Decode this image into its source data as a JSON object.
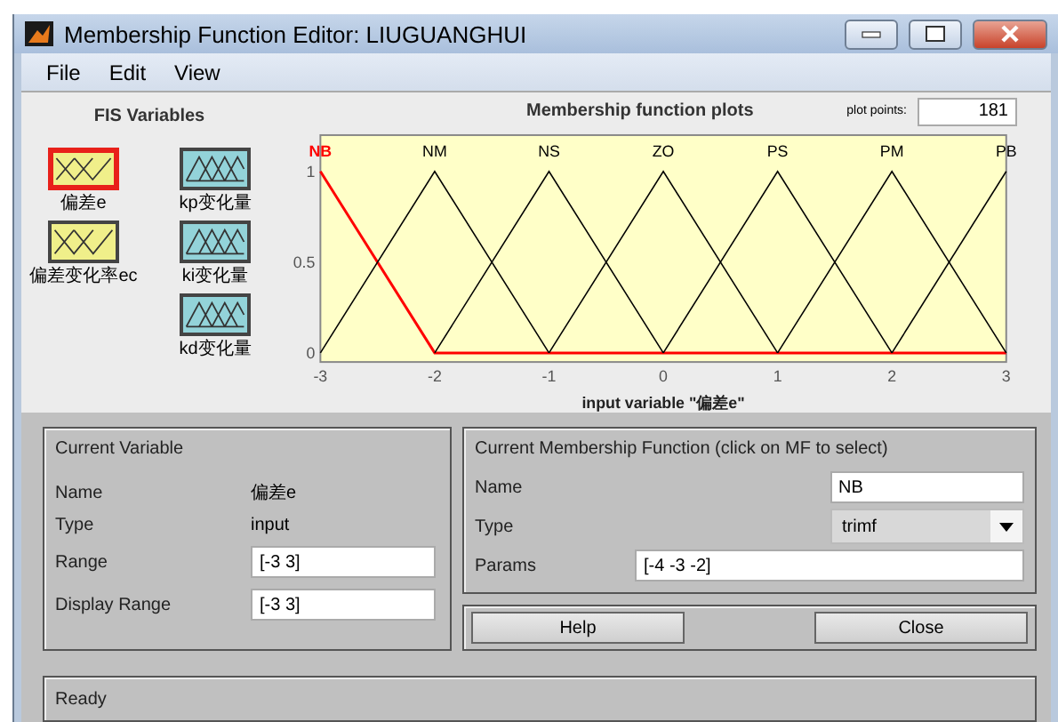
{
  "window": {
    "title": "Membership Function Editor: LIUGUANGHUI"
  },
  "menu": [
    "File",
    "Edit",
    "View"
  ],
  "fis_variables": {
    "title": "FIS Variables",
    "items": [
      {
        "label": "偏差e",
        "kind": "input",
        "selected": true
      },
      {
        "label": "kp变化量",
        "kind": "output",
        "selected": false
      },
      {
        "label": "偏差变化率ec",
        "kind": "input",
        "selected": false
      },
      {
        "label": "ki变化量",
        "kind": "output",
        "selected": false
      },
      {
        "label": "kd变化量",
        "kind": "output",
        "selected": false
      }
    ]
  },
  "plot": {
    "title": "Membership function plots",
    "plot_points_label": "plot points:",
    "plot_points": "181",
    "chart_data": {
      "type": "line",
      "xlabel": "input variable \"偏差e\"",
      "x": [
        -3,
        -2,
        -1,
        0,
        1,
        2,
        3
      ],
      "xlim": [
        -3,
        3
      ],
      "ylim": [
        -0.05,
        1.2
      ],
      "xticks": [
        -3,
        -2,
        -1,
        0,
        1,
        2,
        3
      ],
      "yticks": [
        0,
        0.5,
        1
      ],
      "series": [
        {
          "name": "NB",
          "color": "#ff0000",
          "values": [
            1,
            0,
            0,
            0,
            0,
            0,
            0
          ]
        },
        {
          "name": "NM",
          "color": "#000000",
          "values": [
            0,
            1,
            0,
            null,
            null,
            null,
            null
          ]
        },
        {
          "name": "NS",
          "color": "#000000",
          "values": [
            null,
            0,
            1,
            0,
            null,
            null,
            null
          ]
        },
        {
          "name": "ZO",
          "color": "#000000",
          "values": [
            null,
            null,
            0,
            1,
            0,
            null,
            null
          ]
        },
        {
          "name": "PS",
          "color": "#000000",
          "values": [
            null,
            null,
            null,
            0,
            1,
            0,
            null
          ]
        },
        {
          "name": "PM",
          "color": "#000000",
          "values": [
            null,
            null,
            null,
            null,
            0,
            1,
            0
          ]
        },
        {
          "name": "PB",
          "color": "#000000",
          "values": [
            null,
            null,
            null,
            null,
            null,
            0,
            1
          ]
        }
      ]
    }
  },
  "current_variable": {
    "title": "Current Variable",
    "fields": [
      {
        "label": "Name",
        "value": "偏差e",
        "kind": "text"
      },
      {
        "label": "Type",
        "value": "input",
        "kind": "text"
      },
      {
        "label": "Range",
        "value": "[-3 3]",
        "kind": "input"
      },
      {
        "label": "Display Range",
        "value": "[-3 3]",
        "kind": "input"
      }
    ]
  },
  "current_mf": {
    "title": "Current Membership Function (click on MF to select)",
    "name_label": "Name",
    "name": "NB",
    "type_label": "Type",
    "type": "trimf",
    "params_label": "Params",
    "params": "[-4 -3 -2]"
  },
  "buttons": [
    "Help",
    "Close"
  ],
  "status": "Ready"
}
